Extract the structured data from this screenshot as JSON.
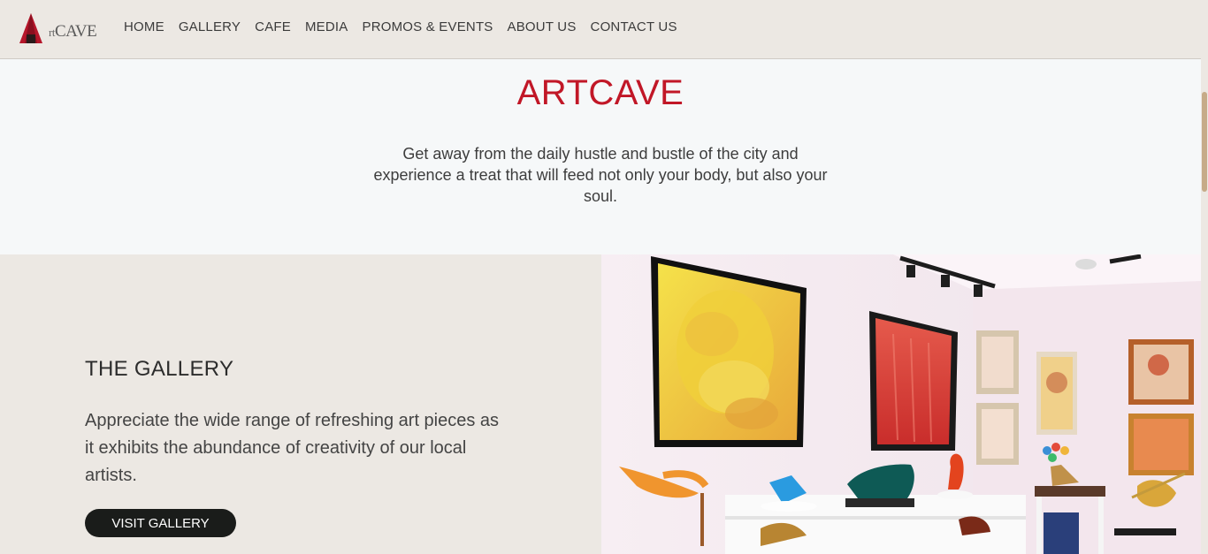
{
  "brand": {
    "logo_letter": "A",
    "logo_small": "rt",
    "logo_rest": "CAVE"
  },
  "nav": {
    "items": [
      {
        "label": "HOME"
      },
      {
        "label": "GALLERY"
      },
      {
        "label": "CAFE"
      },
      {
        "label": "MEDIA"
      },
      {
        "label": "PROMOS & EVENTS"
      },
      {
        "label": "ABOUT US"
      },
      {
        "label": "CONTACT US"
      }
    ]
  },
  "hero": {
    "title": "ARTCAVE",
    "description": "Get away from the daily hustle and bustle of the city and experience a treat that will feed not only your body, but also your soul."
  },
  "gallery": {
    "title": "THE GALLERY",
    "description": "Appreciate the wide range of refreshing art pieces as it exhibits the abundance of creativity of our local artists.",
    "button_label": "VISIT GALLERY"
  },
  "colors": {
    "brand_red": "#c11727",
    "header_bg": "#ece8e3",
    "button_bg": "#1a1c1a",
    "scroll_thumb": "#c6ab88"
  }
}
